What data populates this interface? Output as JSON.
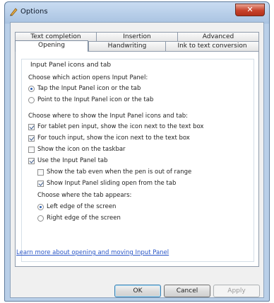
{
  "window": {
    "title": "Options",
    "close_label": "✕"
  },
  "tabs": {
    "back_row": [
      "Text completion",
      "Insertion",
      "Advanced"
    ],
    "front_row": [
      "Opening",
      "Handwriting",
      "Ink to text conversion"
    ],
    "active": "Opening"
  },
  "group": {
    "title": "Input Panel icons and tab",
    "action_prompt": "Choose which action opens Input Panel:",
    "action_options": [
      {
        "label": "Tap the Input Panel icon or the tab",
        "checked": true
      },
      {
        "label": "Point to the Input Panel icon or the tab",
        "checked": false
      }
    ],
    "where_prompt": "Choose where to show the Input Panel icons and tab:",
    "where_options": [
      {
        "label": "For tablet pen input, show the icon next to the text box",
        "checked": true
      },
      {
        "label": "For touch input, show the icon next to the text box",
        "checked": true
      },
      {
        "label": "Show the icon on the taskbar",
        "checked": false
      },
      {
        "label": "Use the Input Panel tab",
        "checked": true
      }
    ],
    "tab_options": [
      {
        "label": "Show the tab even when the pen is out of range",
        "checked": false
      },
      {
        "label": "Show Input Panel sliding open from the tab",
        "checked": true
      }
    ],
    "edge_prompt": "Choose where the tab appears:",
    "edge_options": [
      {
        "label": "Left edge of the screen",
        "checked": true
      },
      {
        "label": "Right edge of the screen",
        "checked": false
      }
    ]
  },
  "link": {
    "text": "Learn more about opening and moving Input Panel"
  },
  "buttons": {
    "ok": "OK",
    "cancel": "Cancel",
    "apply": "Apply"
  }
}
